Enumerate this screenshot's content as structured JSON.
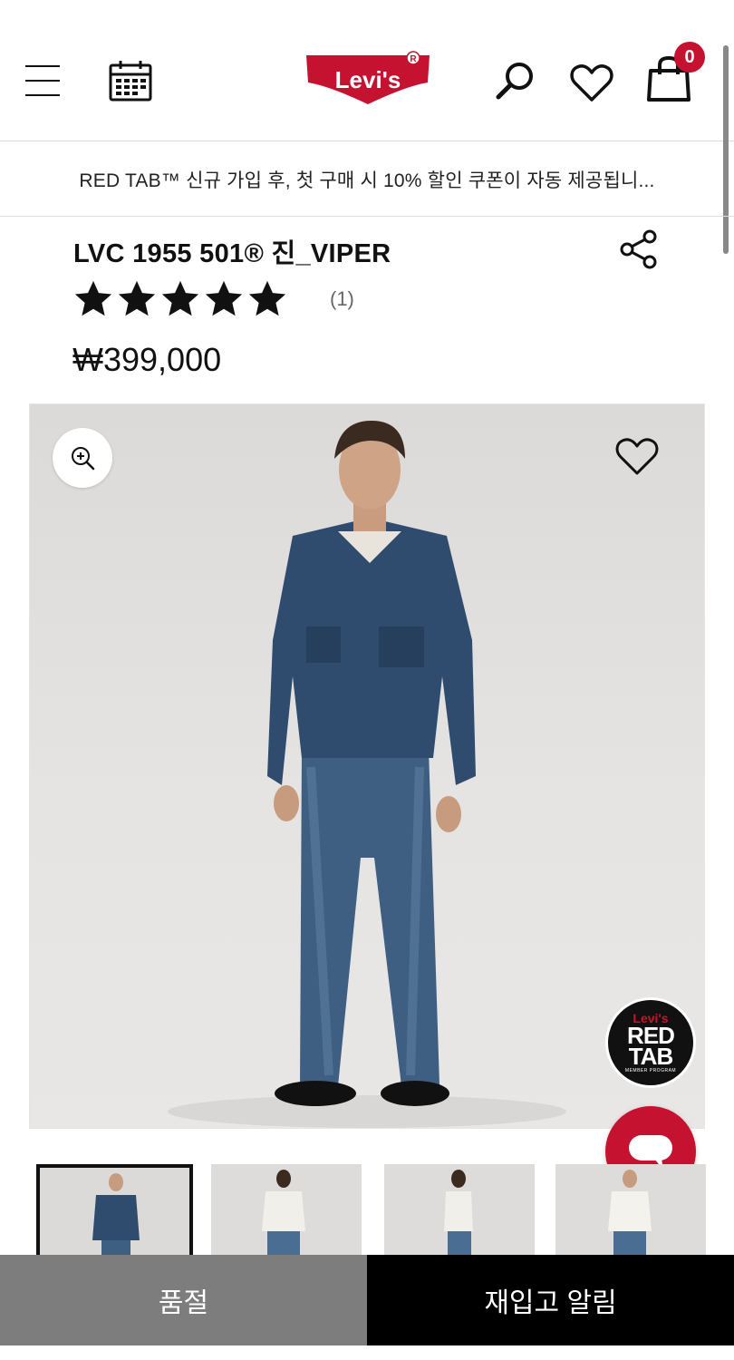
{
  "header": {
    "menu_icon": "hamburger-menu-icon",
    "calendar_icon": "calendar-icon",
    "logo_text": "Levi's",
    "logo_registered": "®",
    "search_icon": "search-icon",
    "wishlist_icon": "heart-icon",
    "cart_icon": "shopping-bag-icon",
    "cart_count": "0",
    "brand_red": "#c41230"
  },
  "promo": {
    "text": "RED TAB™ 신규 가입 후, 첫 구매 시 10% 할인 쿠폰이 자동 제공됩니..."
  },
  "product": {
    "title": "LVC 1955 501® 진_VIPER",
    "rating": 5,
    "review_count": "(1)",
    "price": "₩399,000",
    "share_icon": "share-icon"
  },
  "gallery": {
    "zoom_icon": "zoom-in-icon",
    "wishlist_icon": "heart-icon",
    "badge": {
      "brand": "Levi's",
      "line1": "RED",
      "line2": "TAB",
      "sub": "MEMBER PROGRAM"
    },
    "chat_icon": "chat-bubble-icon",
    "thumbnails": [
      "front-jacket",
      "back-tshirt",
      "side-tshirt",
      "front-tshirt"
    ],
    "active_thumbnail": 0
  },
  "actions": {
    "soldout_label": "품절",
    "restock_label": "재입고 알림"
  }
}
